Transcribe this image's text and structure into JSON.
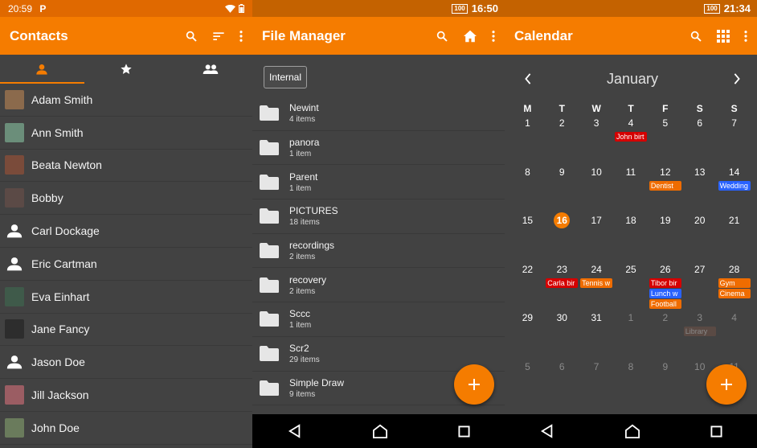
{
  "colors": {
    "accent": "#f57c00",
    "background": "#424242",
    "event_red": "#d50000",
    "event_orange": "#ef6c00",
    "event_blue": "#2962ff",
    "event_brown": "#795548"
  },
  "contacts": {
    "status_time": "20:59",
    "status_app_letter": "P",
    "title": "Contacts",
    "tabs": [
      "person-icon",
      "star-icon",
      "group-icon"
    ],
    "items": [
      {
        "name": "Adam Smith",
        "avatar": "#8b6a4c"
      },
      {
        "name": "Ann Smith",
        "avatar": "#6b8e7a"
      },
      {
        "name": "Beata Newton",
        "avatar": "#7a4b3a"
      },
      {
        "name": "Bobby",
        "avatar": "#5b4a46"
      },
      {
        "name": "Carl Dockage",
        "avatar": ""
      },
      {
        "name": "Eric Cartman",
        "avatar": ""
      },
      {
        "name": "Eva Einhart",
        "avatar": "#3f5a4a"
      },
      {
        "name": "Jane Fancy",
        "avatar": "#2d2d2d"
      },
      {
        "name": "Jason Doe",
        "avatar": ""
      },
      {
        "name": "Jill Jackson",
        "avatar": "#9b5d63"
      },
      {
        "name": "John Doe",
        "avatar": "#6a7b5c"
      }
    ]
  },
  "files": {
    "status_battery": "100",
    "status_time": "16:50",
    "title": "File Manager",
    "path": "Internal",
    "items": [
      {
        "name": "Newint",
        "count": "4 items"
      },
      {
        "name": "panora",
        "count": "1 item"
      },
      {
        "name": "Parent",
        "count": "1 item"
      },
      {
        "name": "PICTURES",
        "count": "18 items"
      },
      {
        "name": "recordings",
        "count": "2 items"
      },
      {
        "name": "recovery",
        "count": "2 items"
      },
      {
        "name": "Sccc",
        "count": "1 item"
      },
      {
        "name": "Scr2",
        "count": "29 items"
      },
      {
        "name": "Simple Draw",
        "count": "9 items"
      }
    ]
  },
  "calendar": {
    "status_battery": "100",
    "status_time": "21:34",
    "title": "Calendar",
    "month": "January",
    "weekdays": [
      "M",
      "T",
      "W",
      "T",
      "F",
      "S",
      "S"
    ],
    "weeks": [
      [
        {
          "d": "1"
        },
        {
          "d": "2"
        },
        {
          "d": "3"
        },
        {
          "d": "4",
          "events": [
            {
              "t": "John birt",
              "c": "#d50000"
            }
          ]
        },
        {
          "d": "5"
        },
        {
          "d": "6"
        },
        {
          "d": "7"
        }
      ],
      [
        {
          "d": "8"
        },
        {
          "d": "9"
        },
        {
          "d": "10"
        },
        {
          "d": "11"
        },
        {
          "d": "12",
          "events": [
            {
              "t": "Dentist",
              "c": "#ef6c00"
            }
          ]
        },
        {
          "d": "13"
        },
        {
          "d": "14",
          "events": [
            {
              "t": "Wedding",
              "c": "#2962ff"
            }
          ]
        }
      ],
      [
        {
          "d": "15"
        },
        {
          "d": "16",
          "today": true
        },
        {
          "d": "17"
        },
        {
          "d": "18"
        },
        {
          "d": "19"
        },
        {
          "d": "20"
        },
        {
          "d": "21"
        }
      ],
      [
        {
          "d": "22"
        },
        {
          "d": "23",
          "events": [
            {
              "t": "Carla bir",
              "c": "#d50000"
            }
          ]
        },
        {
          "d": "24",
          "events": [
            {
              "t": "Tennis w",
              "c": "#ef6c00"
            }
          ]
        },
        {
          "d": "25"
        },
        {
          "d": "26",
          "events": [
            {
              "t": "Tibor bir",
              "c": "#d50000"
            },
            {
              "t": "Lunch w",
              "c": "#2962ff"
            },
            {
              "t": "Football",
              "c": "#ef6c00"
            }
          ]
        },
        {
          "d": "27"
        },
        {
          "d": "28",
          "events": [
            {
              "t": "Gym",
              "c": "#ef6c00"
            },
            {
              "t": "Cinema",
              "c": "#ef6c00"
            }
          ]
        }
      ],
      [
        {
          "d": "29"
        },
        {
          "d": "30"
        },
        {
          "d": "31"
        },
        {
          "d": "1",
          "dim": true
        },
        {
          "d": "2",
          "dim": true
        },
        {
          "d": "3",
          "dim": true,
          "events": [
            {
              "t": "Library",
              "c": "#795548",
              "faded": true
            }
          ]
        },
        {
          "d": "4",
          "dim": true
        }
      ],
      [
        {
          "d": "5",
          "dim": true
        },
        {
          "d": "6",
          "dim": true
        },
        {
          "d": "7",
          "dim": true
        },
        {
          "d": "8",
          "dim": true
        },
        {
          "d": "9",
          "dim": true
        },
        {
          "d": "10",
          "dim": true
        },
        {
          "d": "11",
          "dim": true
        }
      ]
    ]
  }
}
